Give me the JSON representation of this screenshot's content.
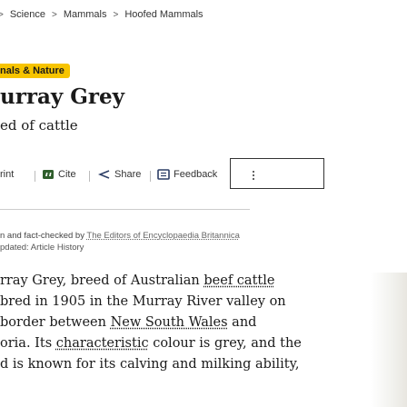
{
  "breadcrumb": {
    "lead_sep": ">",
    "items": [
      "Science",
      "Mammals",
      "Hoofed Mammals"
    ],
    "sep": ">"
  },
  "category_tag": "nals & Nature",
  "title": "urray Grey",
  "subtitle": "ed of cattle",
  "toolbar": {
    "print": "rint",
    "cite": "Cite",
    "share": "Share",
    "feedback": "Feedback"
  },
  "checked_by": {
    "prefix": "n and fact-checked by",
    "editors": "The Editors of Encyclopaedia Britannica"
  },
  "updated": "pdated: Article History",
  "article": {
    "l1_pre": "rray Grey, breed of Australian ",
    "l1_link": "beef cattle",
    "l2": " bred in 1905 in the Murray River valley on",
    "l3_pre": "border between ",
    "l3_link": "New South Wales",
    "l3_post": " and",
    "l4_pre": "oria. Its ",
    "l4_link": "characteristic",
    "l4_post": " colour is grey, and the",
    "l5": "d is known for its calving and milking ability,"
  },
  "colors": {
    "tag_bg": "#f7c400",
    "text": "#1a1a1a"
  }
}
